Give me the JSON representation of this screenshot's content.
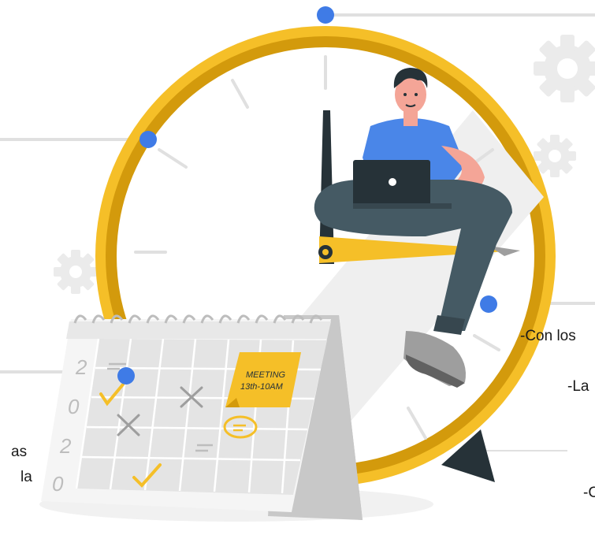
{
  "calendar": {
    "year_digits": [
      "2",
      "0",
      "2",
      "0"
    ],
    "note_line1": "MEETING",
    "note_line2": "13th-10AM"
  },
  "text_fragments": {
    "right_1": "-Con los",
    "right_2": "-La",
    "right_3": "-C",
    "left_1": "as",
    "left_2": "la"
  },
  "colors": {
    "clock_ring": "#F5BF28",
    "clock_ring_dark": "#D39A0C",
    "shirt": "#4A86E8",
    "pants": "#455A64",
    "connector_dot": "#3F7BE6",
    "connector_line": "#E0E0E0",
    "gear": "#EBEBEB"
  }
}
